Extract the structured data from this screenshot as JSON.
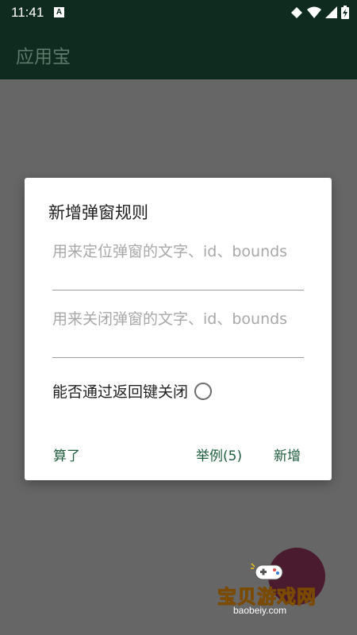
{
  "status_bar": {
    "time": "11:41",
    "notif_letter": "A"
  },
  "app_bar": {
    "title": "应用宝"
  },
  "dialog": {
    "title": "新增弹窗规则",
    "field_locate_placeholder": "用来定位弹窗的文字、id、bounds",
    "field_close_placeholder": "用来关闭弹窗的文字、id、bounds",
    "checkbox_label": "能否通过返回键关闭",
    "checkbox_checked": false,
    "btn_cancel": "算了",
    "btn_example": "举例(5)",
    "btn_add": "新增"
  },
  "watermark": {
    "title": "宝贝游戏网",
    "url": "baobeiy.com"
  },
  "colors": {
    "app_bar": "#0f2a1e",
    "accent": "#1f5d3f",
    "scrim": "#666666"
  }
}
